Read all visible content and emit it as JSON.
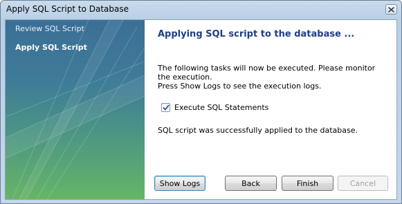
{
  "window": {
    "title": "Apply SQL Script to Database"
  },
  "sidebar": {
    "steps": [
      {
        "label": "Review SQL Script"
      },
      {
        "label": "Apply SQL Script"
      }
    ]
  },
  "main": {
    "heading": "Applying SQL script to the database ...",
    "description_line1": "The following tasks will now be executed. Please monitor the execution.",
    "description_line2": "Press Show Logs to see the execution logs.",
    "task": {
      "label": "Execute SQL Statements",
      "checked": true
    },
    "status": "SQL script was successfully applied to the database."
  },
  "buttons": {
    "show_logs": "Show Logs",
    "back": "Back",
    "finish": "Finish",
    "cancel": "Cancel"
  },
  "colors": {
    "heading": "#1e3d8a",
    "sidebar_top": "#3b6f96",
    "sidebar_bottom": "#66b567"
  },
  "icons": {
    "close": "close-icon",
    "check": "checkmark-icon"
  }
}
